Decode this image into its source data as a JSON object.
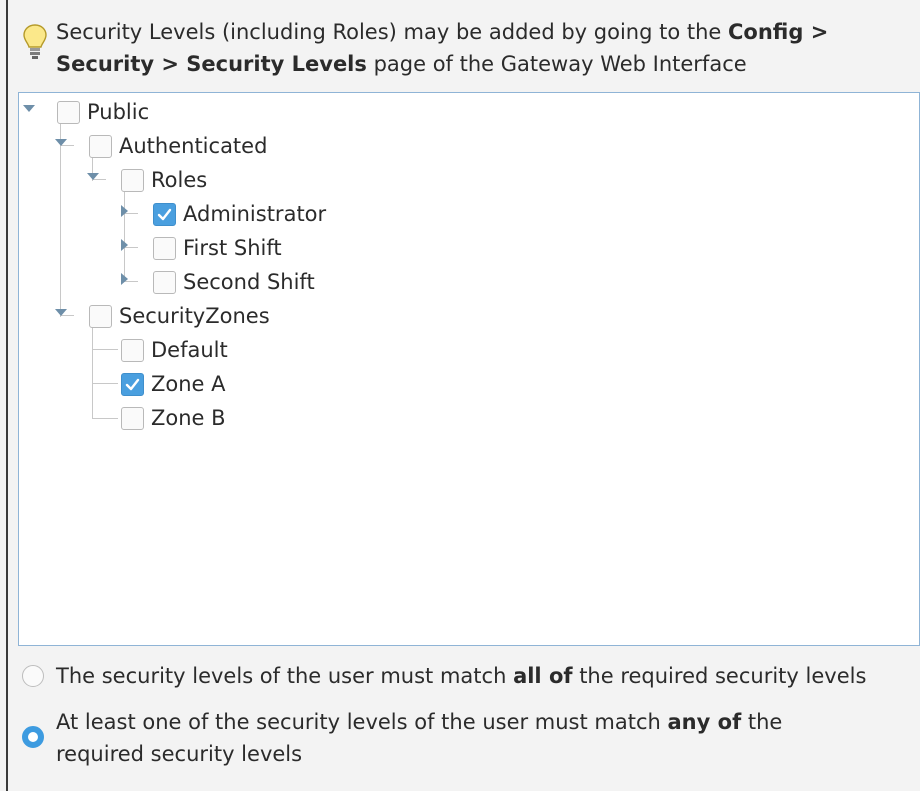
{
  "info": {
    "icon": "lightbulb-icon",
    "text_part1": "Security Levels (including Roles) may be added by going to the ",
    "bold1": "Config >",
    "bold2": "Security > Security Levels",
    "text_part2": " page of the Gateway Web Interface"
  },
  "tree": {
    "public": {
      "label": "Public",
      "checked": false
    },
    "authenticated": {
      "label": "Authenticated",
      "checked": false
    },
    "roles": {
      "label": "Roles",
      "checked": false
    },
    "administrator": {
      "label": "Administrator",
      "checked": true
    },
    "first_shift": {
      "label": "First Shift",
      "checked": false
    },
    "second_shift": {
      "label": "Second Shift",
      "checked": false
    },
    "security_zones": {
      "label": "SecurityZones",
      "checked": false
    },
    "default": {
      "label": "Default",
      "checked": false
    },
    "zone_a": {
      "label": "Zone A",
      "checked": true
    },
    "zone_b": {
      "label": "Zone B",
      "checked": false
    }
  },
  "match_options": {
    "all": {
      "pre": "The security levels of the user must match ",
      "bold": "all of",
      "post": " the required security levels",
      "selected": false
    },
    "any": {
      "pre": "At least one of the security levels of the user must match ",
      "bold": "any of",
      "post": " the",
      "line2": "required security levels",
      "selected": true
    }
  },
  "colors": {
    "accent": "#4a9fdf",
    "tree_border": "#8fb4d6"
  }
}
